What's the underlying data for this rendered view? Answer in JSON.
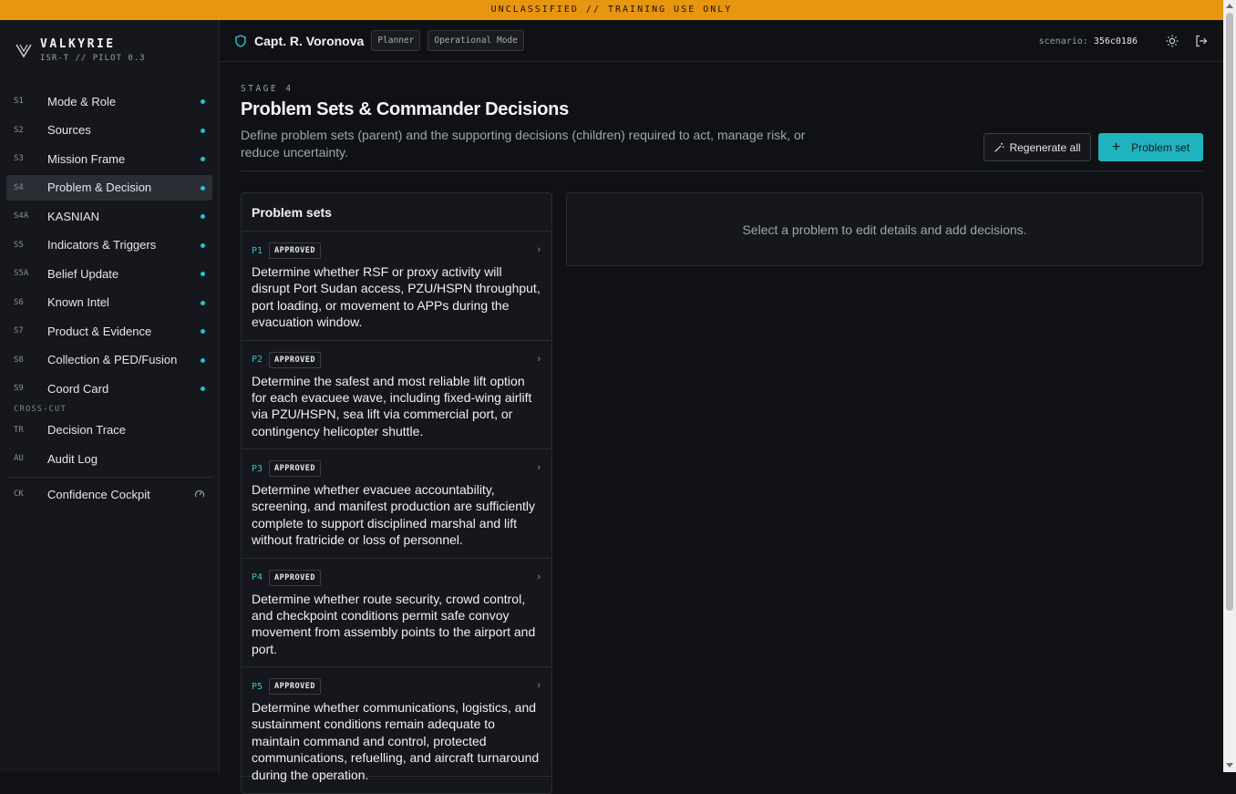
{
  "banner": {
    "text": "UNCLASSIFIED // TRAINING USE ONLY"
  },
  "brand": {
    "title": "VALKYRIE",
    "subtitle": "ISR-T // PILOT 0.3"
  },
  "sidebar": {
    "items": [
      {
        "code": "S1",
        "label": "Mode & Role",
        "status": true
      },
      {
        "code": "S2",
        "label": "Sources",
        "status": true
      },
      {
        "code": "S3",
        "label": "Mission Frame",
        "status": true
      },
      {
        "code": "S4",
        "label": "Problem & Decision",
        "status": true,
        "active": true
      },
      {
        "code": "S4A",
        "label": "KASNIAN",
        "status": true
      },
      {
        "code": "S5",
        "label": "Indicators & Triggers",
        "status": true
      },
      {
        "code": "S5A",
        "label": "Belief Update",
        "status": true
      },
      {
        "code": "S6",
        "label": "Known Intel",
        "status": true
      },
      {
        "code": "S7",
        "label": "Product & Evidence",
        "status": true
      },
      {
        "code": "S8",
        "label": "Collection & PED/Fusion",
        "status": true
      },
      {
        "code": "S9",
        "label": "Coord Card",
        "status": true
      }
    ],
    "crosscut_label": "CROSS-CUT",
    "crosscut_items": [
      {
        "code": "TR",
        "label": "Decision Trace"
      },
      {
        "code": "AU",
        "label": "Audit Log"
      }
    ],
    "cockpit": {
      "code": "CK",
      "label": "Confidence Cockpit",
      "icon": "gauge-icon"
    }
  },
  "topbar": {
    "user": "Capt. R. Voronova",
    "role": "Planner",
    "mode": "Operational Mode",
    "scenario_label": "scenario:",
    "scenario_id": "356c0186",
    "icons": [
      "sun-icon",
      "logout-icon"
    ]
  },
  "page": {
    "stage": "STAGE 4",
    "title": "Problem Sets & Commander Decisions",
    "description": "Define problem sets (parent) and the supporting decisions (children) required to act, manage risk, or reduce uncertainty.",
    "regenerate_label": "Regenerate all",
    "add_label": "Problem set",
    "panel_title": "Problem sets",
    "detail_placeholder": "Select a problem to edit details and add decisions."
  },
  "problems": [
    {
      "id": "P1",
      "status": "APPROVED",
      "text": "Determine whether RSF or proxy activity will disrupt Port Sudan access, PZU/HSPN throughput, port loading, or movement to APPs during the evacuation window."
    },
    {
      "id": "P2",
      "status": "APPROVED",
      "text": "Determine the safest and most reliable lift option for each evacuee wave, including fixed-wing airlift via PZU/HSPN, sea lift via commercial port, or contingency helicopter shuttle."
    },
    {
      "id": "P3",
      "status": "APPROVED",
      "text": "Determine whether evacuee accountability, screening, and manifest production are sufficiently complete to support disciplined marshal and lift without fratricide or loss of personnel."
    },
    {
      "id": "P4",
      "status": "APPROVED",
      "text": "Determine whether route security, crowd control, and checkpoint conditions permit safe convoy movement from assembly points to the airport and port."
    },
    {
      "id": "P5",
      "status": "APPROVED",
      "text": "Determine whether communications, logistics, and sustainment conditions remain adequate to maintain command and control, protected communications, refuelling, and aircraft turnaround during the operation."
    }
  ],
  "colors": {
    "accent": "#1fb3c0",
    "banner": "#e8950f",
    "background": "#0f1115",
    "sidebar": "#15171c"
  }
}
